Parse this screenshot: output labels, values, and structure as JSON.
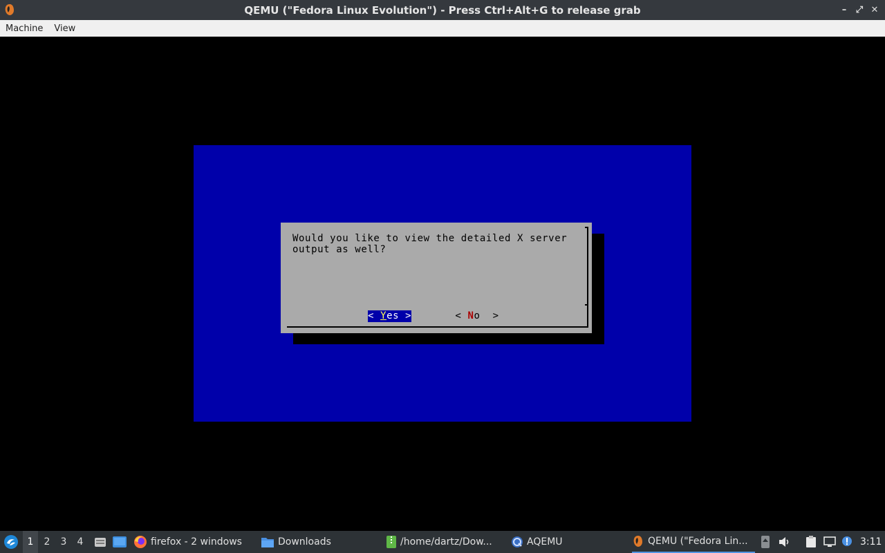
{
  "window": {
    "title": "QEMU (\"Fedora Linux Evolution\") - Press Ctrl+Alt+G to release grab",
    "controls": [
      "–",
      "⤢",
      "✕"
    ]
  },
  "menubar": {
    "items": [
      "Machine",
      "View"
    ]
  },
  "dialog": {
    "message_line1": "Would you like to view the detailed X server",
    "message_line2": "output as well?",
    "yes_left": "< ",
    "yes_hot": "Y",
    "yes_rest": "es >",
    "no_left": "< ",
    "no_hot": "N",
    "no_rest": "o  >"
  },
  "taskbar": {
    "desktops": [
      "1",
      "2",
      "3",
      "4"
    ],
    "active_desktop": "1",
    "tasks": [
      {
        "label": "firefox - 2 windows",
        "icon": "firefox-icon"
      },
      {
        "label": "Downloads",
        "icon": "folder-icon"
      },
      {
        "label": "/home/dartz/Dow...",
        "icon": "archive-icon"
      },
      {
        "label": "AQEMU",
        "icon": "aqemu-icon"
      },
      {
        "label": "QEMU (\"Fedora Lin...",
        "icon": "qemu-icon"
      }
    ],
    "clock": "3:11"
  },
  "colors": {
    "guest_blue": "#0000aa",
    "dialog_gray": "#aaaaaa",
    "hotkey_red": "#aa0000",
    "taskbar_bg": "#2d3236",
    "active_task_underline": "#5294e2"
  }
}
